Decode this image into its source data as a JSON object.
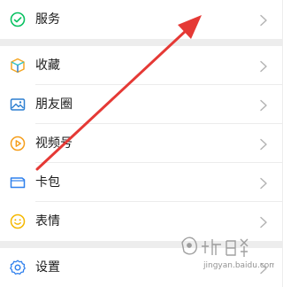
{
  "menu": {
    "items": [
      {
        "label": "服务",
        "icon": "service-icon"
      },
      {
        "label": "收藏",
        "icon": "favorites-icon"
      },
      {
        "label": "朋友圈",
        "icon": "moments-icon"
      },
      {
        "label": "视频号",
        "icon": "channels-icon"
      },
      {
        "label": "卡包",
        "icon": "card-wallet-icon"
      },
      {
        "label": "表情",
        "icon": "stickers-icon"
      },
      {
        "label": "设置",
        "icon": "settings-icon"
      }
    ]
  },
  "colors": {
    "background": "#ededed",
    "service_green": "#07c160",
    "favorites_orange": "#f5a623",
    "favorites_teal": "#35c4c4",
    "moments_blue": "#2d7fd1",
    "channels_orange": "#f59e1c",
    "card_blue": "#2f80ed",
    "sticker_yellow": "#f5b800",
    "settings_blue": "#2f80ed",
    "annotation_red": "#e53935",
    "chevron": "#b2b2b2"
  }
}
